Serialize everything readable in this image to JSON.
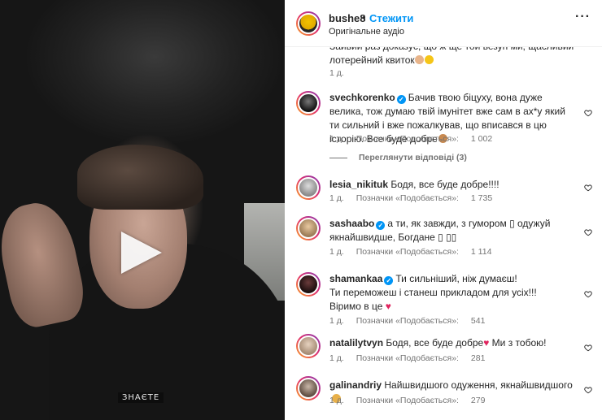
{
  "video": {
    "caption": "ЗНАЄТЕ"
  },
  "header": {
    "author": "bushe8",
    "separator": "•",
    "follow_label": "Стежити",
    "audio_label": "Оригінальне аудіо",
    "more_label": "···"
  },
  "labels": {
    "like": "Позначки «Подобається»:",
    "view_replies": "Переглянути відповіді (3)"
  },
  "comments": [
    {
      "username": "",
      "text": "Зайвий раз доказує, що ж ще той везун ми, щасливий лотерейний квиток",
      "time": "1 д.",
      "likes": ""
    },
    {
      "username": "svechkorenko",
      "verified": true,
      "text": "Бачив твою біцуху, вона дуже велика, тож думаю твій імунітет вже сам в ах*у який ти сильний і вже пожалкував, що вписався в цю історію. Все буде добре",
      "time": "1 д.",
      "likes": "1 002"
    },
    {
      "username": "lesia_nikituk",
      "verified": false,
      "text": "Бодя, все буде добре!!!!",
      "time": "1 д.",
      "likes": "1 735"
    },
    {
      "username": "sashaabo",
      "verified": true,
      "text": "а ти, як завжди, з гумором ▯ одужуй якнайшвидше, Богдане ▯ ▯▯",
      "time": "1 д.",
      "likes": "1 114"
    },
    {
      "username": "shamankaa",
      "verified": true,
      "text_lines": [
        "Ти сильніший, ніж думаєш!",
        "Ти переможеш і станеш прикладом для усіх!!!",
        "Віримо в це"
      ],
      "time": "1 д.",
      "likes": "541"
    },
    {
      "username": "natalilytvyn",
      "verified": false,
      "text": "Бодя, все буде добре",
      "text_after": " Ми з тобою!",
      "time": "1 д.",
      "likes": "281"
    },
    {
      "username": "galinandriy",
      "verified": false,
      "text": "Найшвидшого одуження, якнайшвидшого",
      "time": "1 д.",
      "likes": "279"
    }
  ],
  "colors": {
    "accent": "#0095f6",
    "heart_red": "#e0245e",
    "muted": "#737373"
  }
}
